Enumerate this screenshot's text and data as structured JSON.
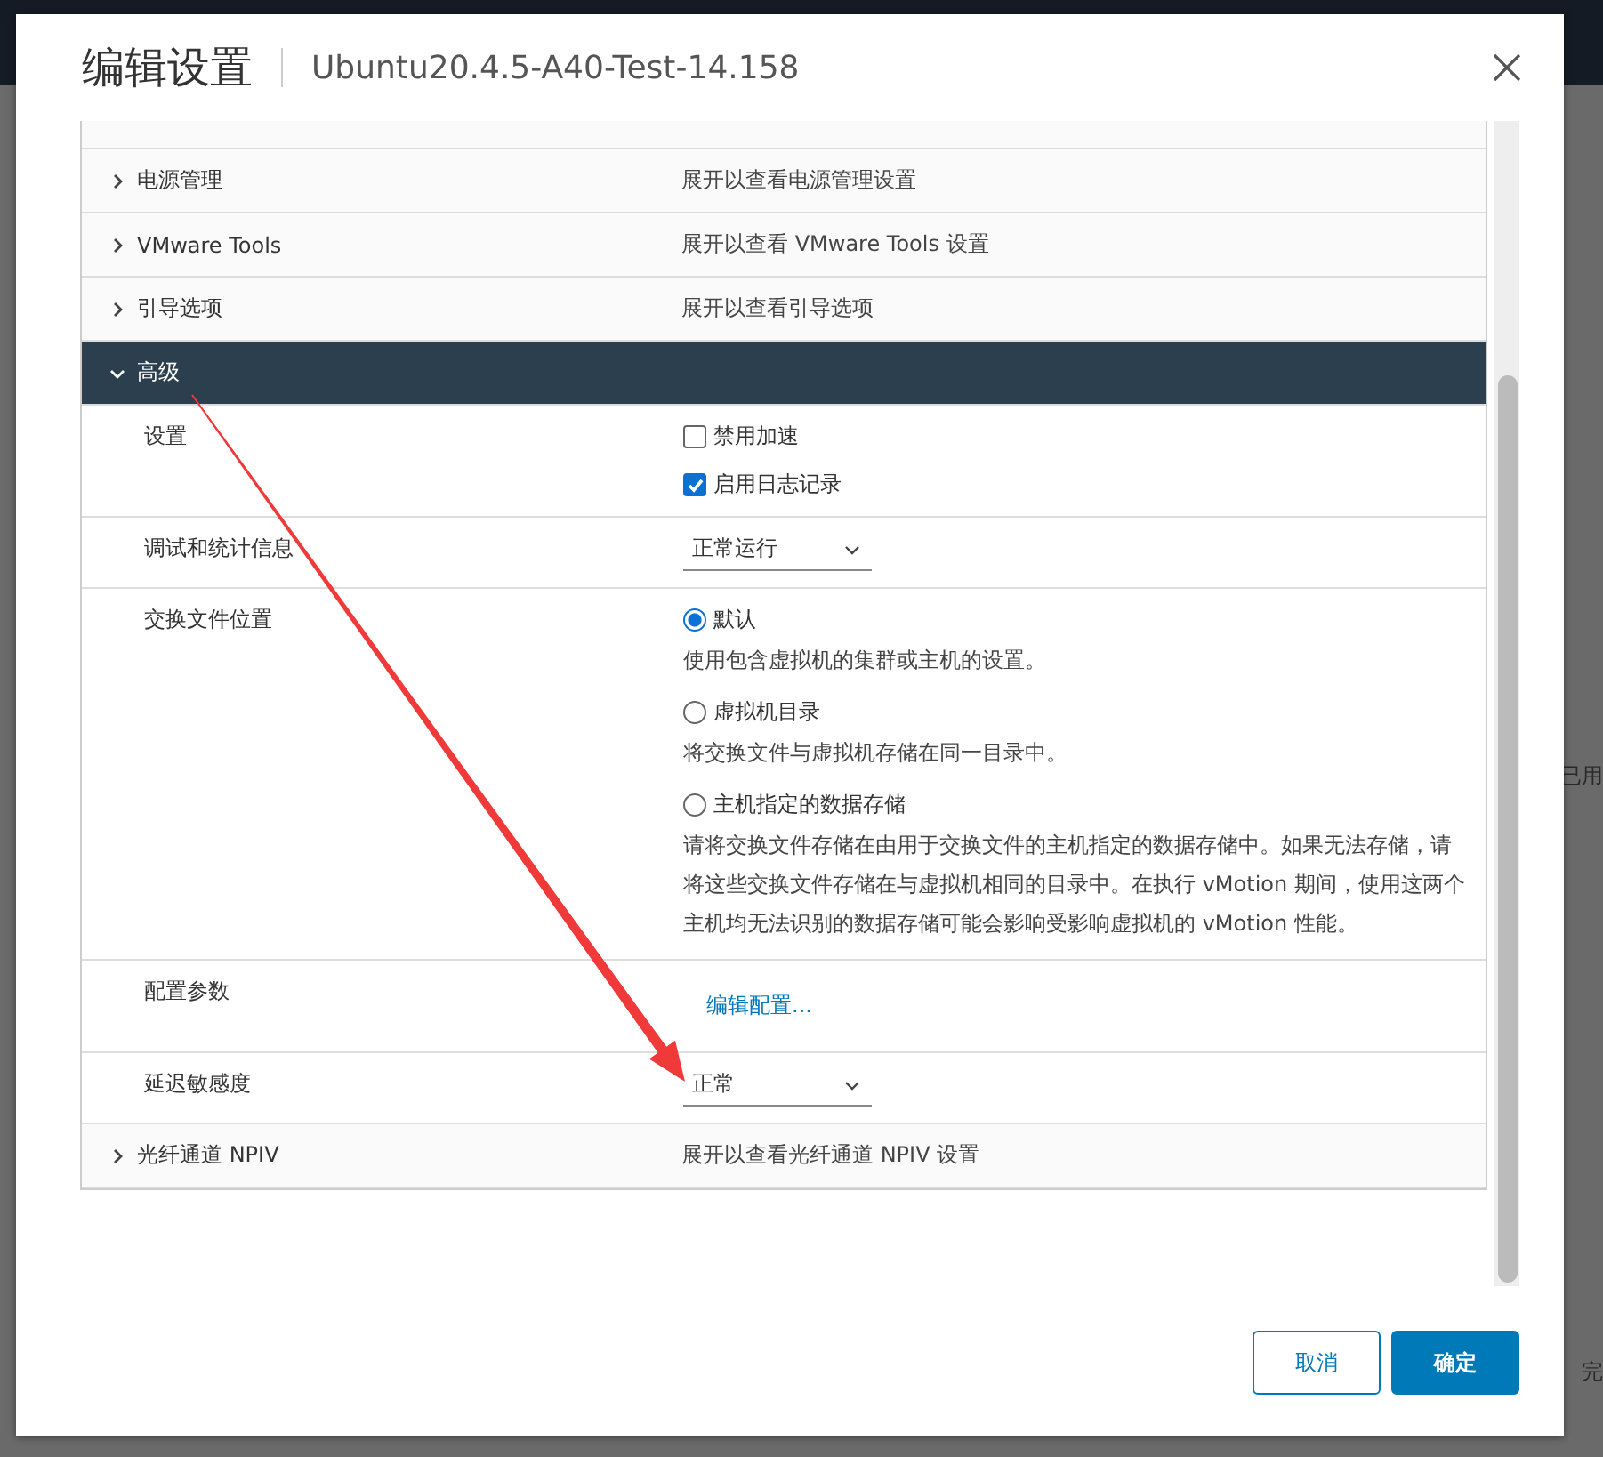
{
  "background": {
    "right_fragments": [
      "已用",
      "完"
    ]
  },
  "dialog": {
    "title": "编辑设置",
    "subtitle": "Ubuntu20.4.5-A40-Test-14.158",
    "sections": [
      {
        "label": "电源管理",
        "summary": "展开以查看电源管理设置",
        "expanded": false
      },
      {
        "label": "VMware Tools",
        "summary": "展开以查看 VMware Tools 设置",
        "expanded": false
      },
      {
        "label": "引导选项",
        "summary": "展开以查看引导选项",
        "expanded": false
      },
      {
        "label": "高级",
        "expanded": true,
        "settings": [
          {
            "kind": "checkboxes",
            "label": "设置",
            "options": [
              {
                "text": "禁用加速",
                "checked": false
              },
              {
                "text": "启用日志记录",
                "checked": true
              }
            ]
          },
          {
            "kind": "select",
            "label": "调试和统计信息",
            "value": "正常运行"
          },
          {
            "kind": "radios",
            "label": "交换文件位置",
            "options": [
              {
                "text": "默认",
                "selected": true,
                "description": "使用包含虚拟机的集群或主机的设置。"
              },
              {
                "text": "虚拟机目录",
                "selected": false,
                "description": "将交换文件与虚拟机存储在同一目录中。"
              },
              {
                "text": "主机指定的数据存储",
                "selected": false,
                "description": "请将交换文件存储在由用于交换文件的主机指定的数据存储中。如果无法存储，请将这些交换文件存储在与虚拟机相同的目录中。在执行 vMotion 期间，使用这两个主机均无法识别的数据存储可能会影响受影响虚拟机的 vMotion 性能。"
              }
            ]
          },
          {
            "kind": "link",
            "label": "配置参数",
            "link": "编辑配置..."
          },
          {
            "kind": "select",
            "label": "延迟敏感度",
            "value": "正常"
          }
        ]
      },
      {
        "label": "光纤通道 NPIV",
        "summary": "展开以查看光纤通道 NPIV 设置",
        "expanded": false
      }
    ],
    "buttons": [
      {
        "label": "取消",
        "kind": "secondary"
      },
      {
        "label": "确定",
        "kind": "primary"
      }
    ]
  }
}
